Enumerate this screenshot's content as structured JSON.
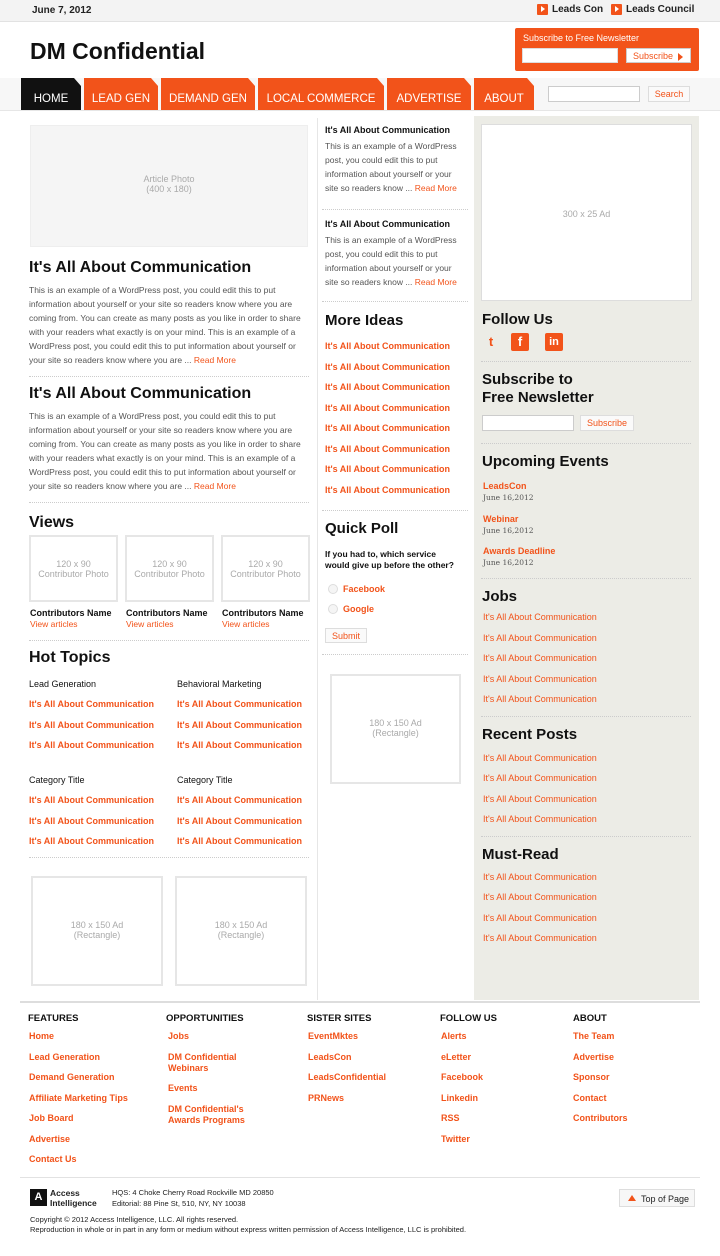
{
  "header": {
    "date": "June 7, 2012",
    "links": [
      "Leads Con",
      "Leads Council"
    ],
    "logo": "DM Confidential",
    "newsletter": {
      "title": "Subscribe to Free Newsletter",
      "button": "Subscribe"
    }
  },
  "nav": {
    "tabs": [
      "HOME",
      "LEAD GEN",
      "DEMAND GEN",
      "LOCAL COMMERCE",
      "ADVERTISE",
      "ABOUT"
    ],
    "search_button": "Search"
  },
  "col1": {
    "photo": [
      "Article Photo",
      "(400 x 180)"
    ],
    "articles": [
      {
        "title": "It's All About Communication",
        "lines": [
          "This is an example of a WordPress post, you could edit this to put",
          "information about yourself or your site so readers know where you are",
          "coming from. You can create as many posts as you like in order to share",
          "with your readers what exactly is on your mind. This is an example of a",
          "WordPress post, you could edit this to put information about yourself or",
          "your site so readers know where you are ..."
        ],
        "more": "Read More"
      },
      {
        "title": "It's All About Communication",
        "lines": [
          "This is an example of a WordPress post, you could edit this to put",
          "information about yourself or your site so readers know where you are",
          "coming from. You can create as many posts as you like in order to share",
          "with your readers what exactly is on your mind. This is an example of a",
          "WordPress post, you could edit this to put information about yourself or",
          "your site so readers know where you are ..."
        ],
        "more": "Read More"
      }
    ],
    "views": {
      "title": "Views",
      "photo": [
        "120 x 90",
        "Contributor Photo"
      ],
      "name": "Contributors Name",
      "link": "View articles"
    },
    "hot": {
      "title": "Hot Topics",
      "cats": [
        "Lead Generation",
        "Behavioral Marketing",
        "Category Title",
        "Category Title"
      ],
      "link": "It's All About Communication"
    },
    "ad": [
      "180 x 150 Ad",
      "(Rectangle)"
    ]
  },
  "col2": {
    "mini": [
      {
        "title": "It's All About Communication",
        "lines": [
          "This is an example of a WordPress",
          "post, you could edit this to put",
          "information about yourself or your",
          "site so readers know ..."
        ],
        "more": "Read More"
      },
      {
        "title": "It's All About Communication",
        "lines": [
          "This is an example of a WordPress",
          "post, you could edit this to put",
          "information about yourself or your",
          "site so readers know ..."
        ],
        "more": "Read More"
      }
    ],
    "more_ideas": {
      "title": "More Ideas",
      "link": "It's All About Communication"
    },
    "poll": {
      "title": "Quick Poll",
      "q1": "If you had to, which service",
      "q2": "would give up before the other?",
      "opts": [
        "Facebook",
        "Google"
      ],
      "submit": "Submit"
    },
    "ad": [
      "180 x 150 Ad",
      "(Rectangle)"
    ]
  },
  "col3": {
    "ad": "300 x 25 Ad",
    "follow": "Follow Us",
    "sub1": "Subscribe to",
    "sub2": "Free Newsletter",
    "sub_btn": "Subscribe",
    "events": {
      "title": "Upcoming Events",
      "items": [
        {
          "name": "LeadsCon",
          "date": "June 16,2012"
        },
        {
          "name": "Webinar",
          "date": "June 16,2012"
        },
        {
          "name": "Awards Deadline",
          "date": "June 16,2012"
        }
      ]
    },
    "jobs": "Jobs",
    "recent": "Recent Posts",
    "must": "Must-Read",
    "link": "It's All About Communication"
  },
  "footer": {
    "cols": [
      {
        "h": "FEATURES",
        "items": [
          "Home",
          "Lead Generation",
          "Demand Generation",
          "Affiliate Marketing Tips",
          "Job Board",
          "Advertise",
          "Contact Us"
        ]
      },
      {
        "h": "OPPORTUNITIES",
        "items": [
          "Jobs",
          "DM Confidential|Webinars",
          "Events",
          "DM Confidential's|Awards Programs"
        ]
      },
      {
        "h": "SISTER SITES",
        "items": [
          "EventMktes",
          "LeadsCon",
          "LeadsConfidential",
          "PRNews"
        ]
      },
      {
        "h": "FOLLOW US",
        "items": [
          "Alerts",
          "eLetter",
          "Facebook",
          "Linkedin",
          "RSS",
          "Twitter"
        ]
      },
      {
        "h": "ABOUT",
        "items": [
          "The Team",
          "Advertise",
          "Sponsor",
          "Contact",
          "Contributors"
        ]
      }
    ],
    "ai1": "Access",
    "ai2": "Intelligence",
    "hqs": "HQS: 4 Choke Cherry Road Rockville MD 20850",
    "ed": "Editorial:  88 Pine St, 510, NY, NY 10038",
    "top": "Top of Page",
    "copy1": "Copyright © 2012 Access Intelligence, LLC. All rights reserved.",
    "copy2": "Reproduction in whole or in part in any form or medium without express written permission of Access Intelligence, LLC is prohibited."
  }
}
